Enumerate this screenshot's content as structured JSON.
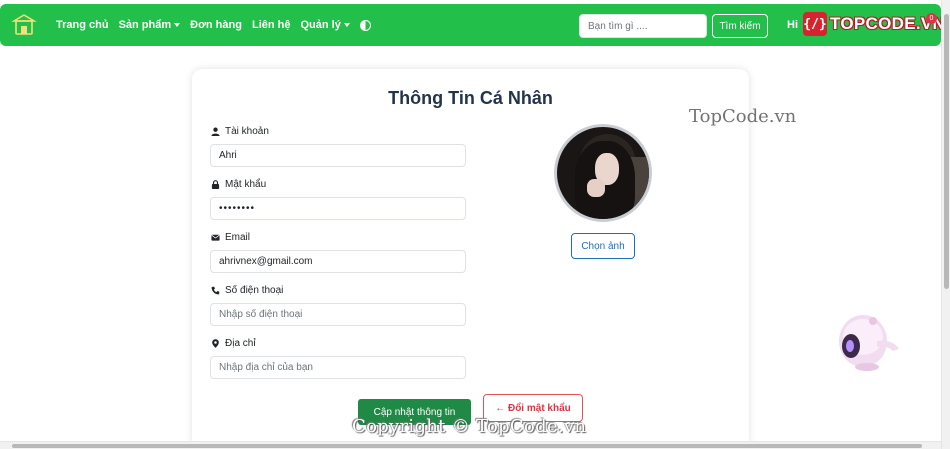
{
  "navbar": {
    "brand_icon": "shop-logo-icon",
    "links": [
      {
        "label": "Trang chủ",
        "dropdown": false
      },
      {
        "label": "Sản phẩm",
        "dropdown": true
      },
      {
        "label": "Đơn hàng",
        "dropdown": false
      },
      {
        "label": "Liên hệ",
        "dropdown": false
      },
      {
        "label": "Quản lý",
        "dropdown": true
      }
    ],
    "theme_icon": "contrast-icon",
    "search": {
      "placeholder": "Bạn tìm gì ....",
      "value": ""
    },
    "search_button": "Tìm kiếm",
    "greeting": "Hi",
    "cart_count": "0",
    "accent_color": "#22c04a"
  },
  "topcode_logo": {
    "mark": "{/}",
    "text": "TOPCODE.VN"
  },
  "profile": {
    "title": "Thông Tin Cá Nhân",
    "fields": {
      "account": {
        "label": "Tài khoản",
        "icon": "user-icon",
        "value": "Ahri",
        "placeholder": ""
      },
      "password": {
        "label": "Mật khẩu",
        "icon": "lock-icon",
        "value": "••••••••",
        "placeholder": ""
      },
      "email": {
        "label": "Email",
        "icon": "envelope-icon",
        "value": "ahrivnex@gmail.com",
        "placeholder": ""
      },
      "phone": {
        "label": "Số điện thoại",
        "icon": "phone-icon",
        "value": "",
        "placeholder": "Nhập số điện thoại"
      },
      "address": {
        "label": "Địa chỉ",
        "icon": "map-marker-icon",
        "value": "",
        "placeholder": "Nhập địa chỉ của bạn"
      }
    },
    "choose_image_button": "Chọn ảnh",
    "update_button": "Cập nhật thông tin",
    "change_password_button": "← Đổi mật khẩu"
  },
  "watermarks": {
    "side": "TopCode.vn",
    "bottom": "Copyright © TopCode.vn"
  }
}
